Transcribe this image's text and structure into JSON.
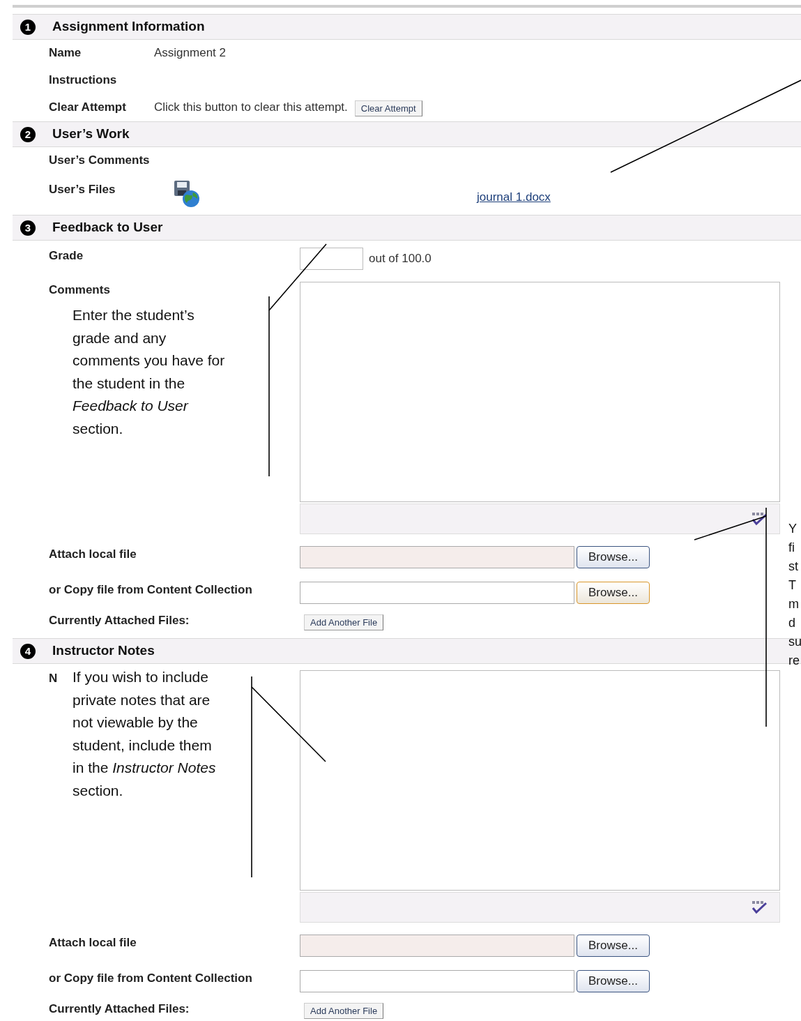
{
  "sections": [
    {
      "number": "1",
      "title": "Assignment Information",
      "rows": [
        {
          "kind": "text",
          "label": "Name",
          "value": "Assignment 2"
        },
        {
          "kind": "text",
          "label": "Instructions"
        },
        {
          "kind": "action",
          "label": "Clear Attempt",
          "value": "Click this button to clear this attempt.",
          "button": "Clear Attempt"
        }
      ]
    },
    {
      "number": "2",
      "title": "User’s Work",
      "rows": [
        {
          "kind": "text",
          "label": "User’s Comments"
        },
        {
          "kind": "files",
          "label": "User’s Files",
          "link": "journal 1.docx"
        }
      ]
    },
    {
      "number": "3",
      "title": "Feedback to User",
      "rows": [
        {
          "kind": "grade",
          "label": "Grade",
          "suffix": "out of 100.0"
        },
        {
          "kind": "editor",
          "label": "Comments"
        },
        {
          "kind": "local_file",
          "label": "Attach local file",
          "button": "Browse...",
          "highlighted": false
        },
        {
          "kind": "collection_file",
          "label": "or Copy file from Content Collection",
          "button": "Browse...",
          "highlighted": true
        },
        {
          "kind": "add_file",
          "label": "Currently Attached Files:",
          "button": "Add Another File"
        }
      ]
    },
    {
      "number": "4",
      "title": "Instructor Notes",
      "rows": [
        {
          "kind": "editor",
          "label": "N"
        },
        {
          "kind": "local_file",
          "label": "Attach local file",
          "button": "Browse...",
          "highlighted": false
        },
        {
          "kind": "collection_file",
          "label": "or Copy file from Content Collection",
          "button": "Browse...",
          "highlighted": false
        },
        {
          "kind": "add_file",
          "label": "Currently Attached Files:",
          "button": "Add Another File"
        }
      ]
    }
  ],
  "callouts": [
    {
      "text": "Enter the student’s grade and any comments you have for the student in the *Feedback to User* section."
    },
    {
      "text": "If you wish to include private notes that are not viewable by the student, include them in the *Instructor Notes* section."
    }
  ],
  "cut_callout": {
    "lines": [
      "Y",
      "fi",
      "st",
      "T",
      "m",
      "d",
      "su",
      "re"
    ]
  }
}
